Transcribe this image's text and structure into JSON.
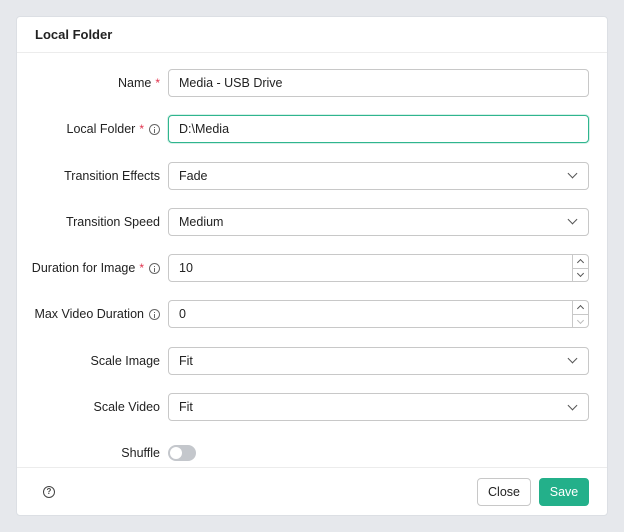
{
  "dialog": {
    "title": "Local Folder"
  },
  "fields": {
    "name": {
      "label": "Name",
      "required_mark": "*",
      "value": "Media - USB Drive"
    },
    "local_folder": {
      "label": "Local Folder",
      "required_mark": "*",
      "value": "D:\\Media"
    },
    "transition_effects": {
      "label": "Transition Effects",
      "value": "Fade"
    },
    "transition_speed": {
      "label": "Transition Speed",
      "value": "Medium"
    },
    "duration_for_image": {
      "label": "Duration for Image",
      "required_mark": "*",
      "value": "10"
    },
    "max_video_duration": {
      "label": "Max Video Duration",
      "value": "0"
    },
    "scale_image": {
      "label": "Scale Image",
      "value": "Fit"
    },
    "scale_video": {
      "label": "Scale Video",
      "value": "Fit"
    },
    "shuffle": {
      "label": "Shuffle",
      "enabled": false
    }
  },
  "footer": {
    "help_glyph": "?",
    "close_label": "Close",
    "save_label": "Save"
  },
  "colors": {
    "accent": "#23b08a",
    "required": "#e0334d",
    "toggle_off": "#c4c7cc"
  }
}
